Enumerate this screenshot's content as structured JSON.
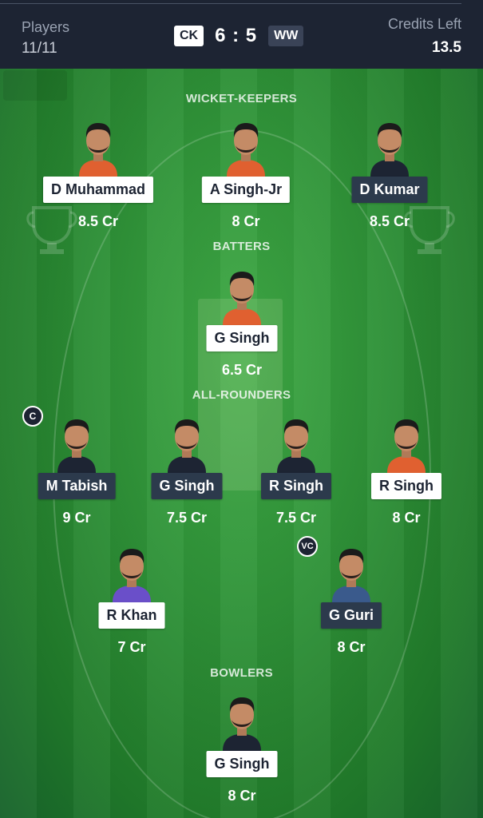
{
  "header": {
    "players_label": "Players",
    "players_value": "11/11",
    "team_left": "CK",
    "score": "6 : 5",
    "team_right": "WW",
    "credits_label": "Credits Left",
    "credits_value": "13.5"
  },
  "sections": {
    "wicket_keepers": "WICKET-KEEPERS",
    "batters": "BATTERS",
    "all_rounders": "ALL-ROUNDERS",
    "bowlers": "BOWLERS"
  },
  "badges": {
    "captain": "C",
    "vice_captain": "VC"
  },
  "players": {
    "wk": [
      {
        "name": "D Muhammad",
        "credits": "8.5 Cr",
        "plate": "light",
        "jersey": "#e06030"
      },
      {
        "name": "A Singh-Jr",
        "credits": "8 Cr",
        "plate": "light",
        "jersey": "#e06030"
      },
      {
        "name": "D Kumar",
        "credits": "8.5 Cr",
        "plate": "dark",
        "jersey": "#1d2433"
      }
    ],
    "bat": [
      {
        "name": "G Singh",
        "credits": "6.5 Cr",
        "plate": "light",
        "jersey": "#e06030"
      }
    ],
    "ar": [
      {
        "name": "M Tabish",
        "credits": "9 Cr",
        "plate": "dark",
        "jersey": "#1d2433"
      },
      {
        "name": "G Singh",
        "credits": "7.5 Cr",
        "plate": "dark",
        "jersey": "#1d2433"
      },
      {
        "name": "R Singh",
        "credits": "7.5 Cr",
        "plate": "dark",
        "jersey": "#1d2433"
      },
      {
        "name": "R Singh",
        "credits": "8 Cr",
        "plate": "light",
        "jersey": "#e06030"
      }
    ],
    "ar2": [
      {
        "name": "R Khan",
        "credits": "7 Cr",
        "plate": "light",
        "jersey": "#6a4fc9"
      },
      {
        "name": "G Guri",
        "credits": "8 Cr",
        "plate": "dark",
        "jersey": "#3a5a8c"
      }
    ],
    "bowl": [
      {
        "name": "G Singh",
        "credits": "8 Cr",
        "plate": "light",
        "jersey": "#1d2433"
      }
    ]
  },
  "colors": {
    "header_bg": "#1d2433",
    "pitch_green": "#2f9238",
    "light_plate": "#ffffff",
    "dark_plate": "#2c3a4c"
  }
}
